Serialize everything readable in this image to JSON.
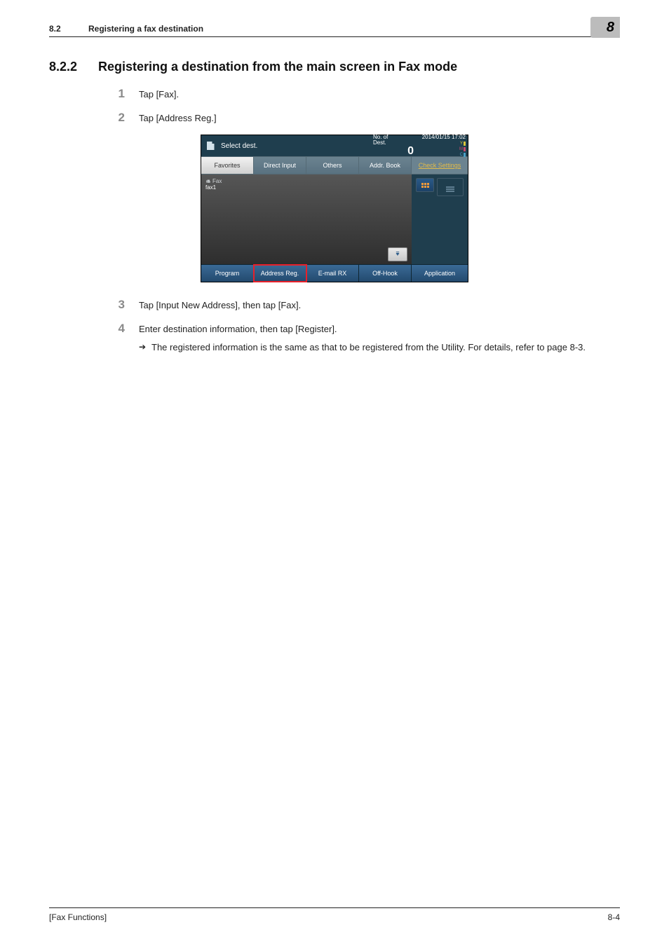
{
  "running_head": {
    "number": "8.2",
    "text": "Registering a fax destination"
  },
  "chapter_tab": "8",
  "section": {
    "number": "8.2.2",
    "title": "Registering a destination from the main screen in Fax mode"
  },
  "steps": {
    "s1": {
      "num": "1",
      "text": "Tap [Fax]."
    },
    "s2": {
      "num": "2",
      "text": "Tap [Address Reg.]"
    },
    "s3": {
      "num": "3",
      "text": "Tap [Input New Address], then tap [Fax]."
    },
    "s4": {
      "num": "4",
      "text": "Enter destination information, then tap [Register].",
      "sub": "The registered information is the same as that to be registered from the Utility. For details, refer to page 8-3."
    }
  },
  "mfp": {
    "title": "Select dest.",
    "nodest_label": "No. of\nDest.",
    "nodest_value": "0",
    "date": "2014/01/15",
    "time": "17:02",
    "tabs": {
      "favorites": "Favorites",
      "direct": "Direct Input",
      "others": "Others",
      "addrbook": "Addr. Book"
    },
    "check_settings": "Check Settings",
    "fax_entry_type": "Fax",
    "fax_entry_name": "fax1",
    "bottom": {
      "program": "Program",
      "addressreg": "Address Reg.",
      "emailrx": "E-mail RX",
      "offhook": "Off-Hook",
      "application": "Application"
    }
  },
  "footer": {
    "left": "[Fax Functions]",
    "right": "8-4"
  }
}
